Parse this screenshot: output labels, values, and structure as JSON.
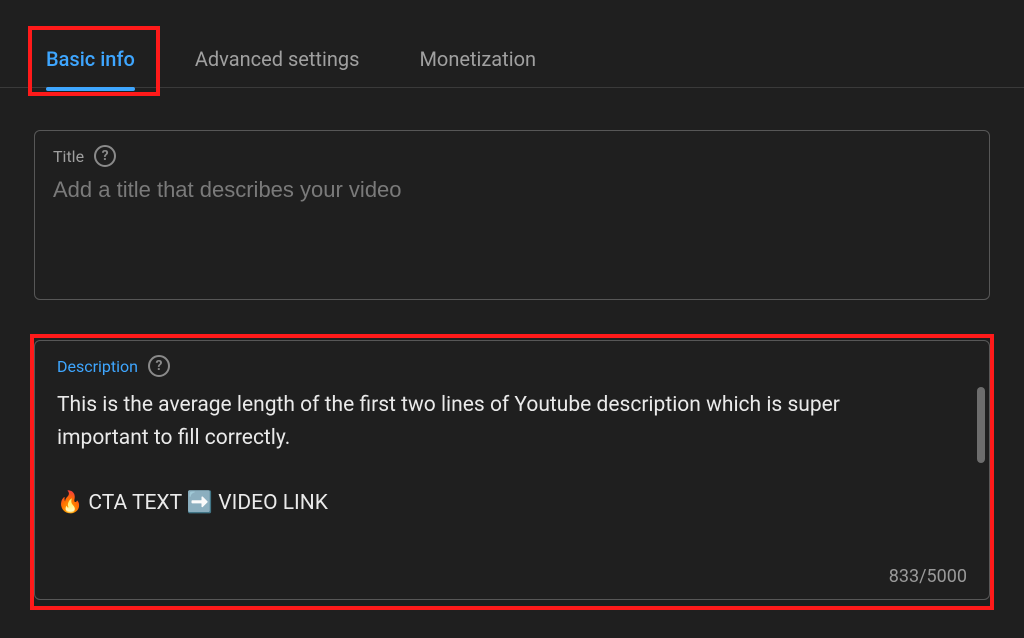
{
  "tabs": {
    "basic": "Basic info",
    "advanced": "Advanced settings",
    "monetization": "Monetization"
  },
  "title_field": {
    "label": "Title",
    "help": "?",
    "placeholder": "Add a title that describes your video",
    "value": ""
  },
  "description_field": {
    "label": "Description",
    "help": "?",
    "value": "This is the average length of the first two lines of Youtube description which is super important to fill correctly.\n\n🔥 CTA TEXT ➡️ VIDEO LINK",
    "char_count": "833/5000"
  }
}
